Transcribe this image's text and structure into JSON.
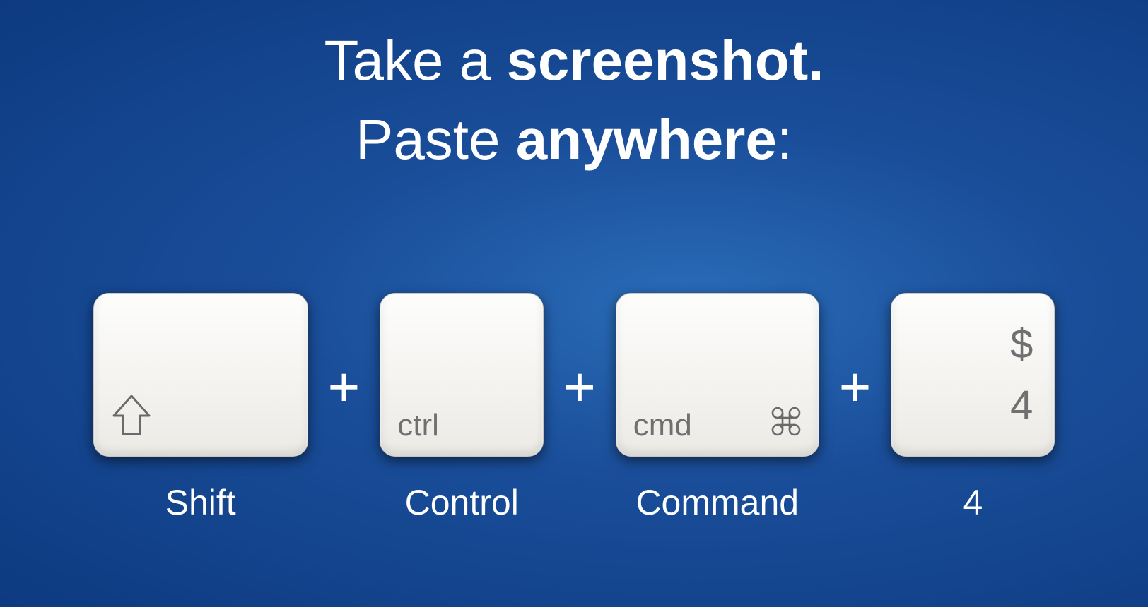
{
  "headline": {
    "line1_prefix": "Take a ",
    "line1_bold": "screenshot.",
    "line2_prefix": "Paste ",
    "line2_bold": "anywhere",
    "line2_suffix": ":"
  },
  "separator": "+",
  "keys": {
    "shift": {
      "under": "Shift"
    },
    "ctrl": {
      "cap": "ctrl",
      "under": "Control"
    },
    "cmd": {
      "cap": "cmd",
      "under": "Command"
    },
    "four": {
      "top": "$",
      "bottom": "4",
      "under": "4"
    }
  }
}
